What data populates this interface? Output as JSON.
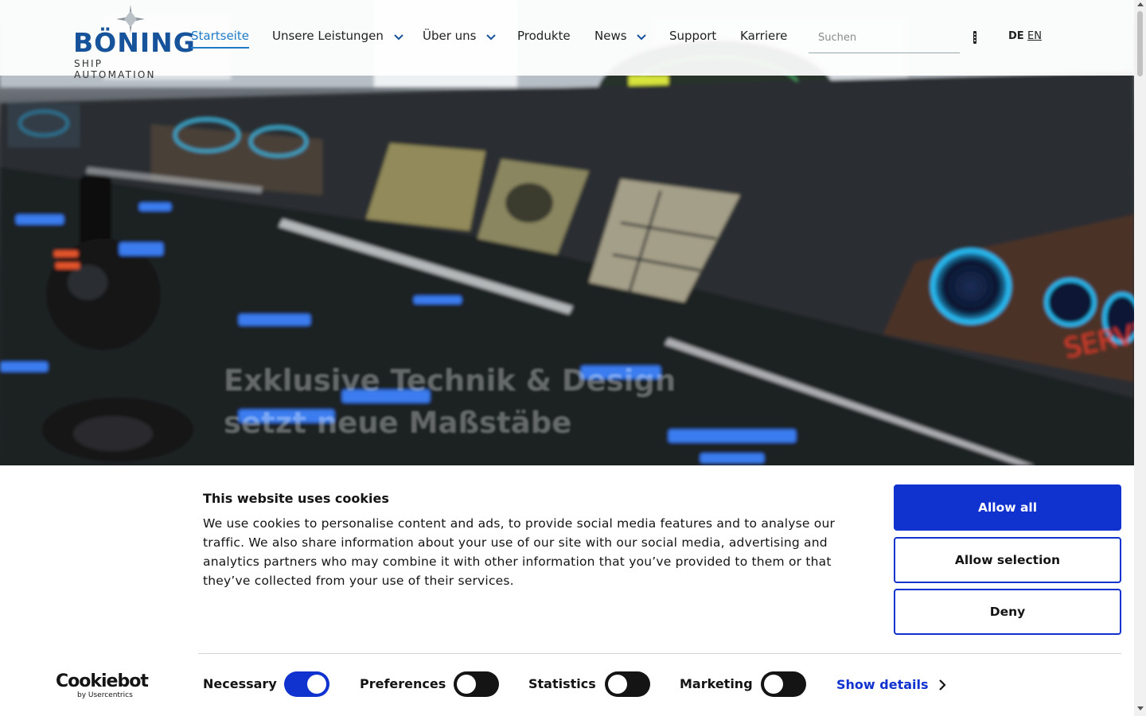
{
  "brand": {
    "name": "BÖNING",
    "tagline": "SHIP AUTOMATION",
    "primary_color": "#16539a"
  },
  "nav": {
    "items": [
      {
        "label": "Startseite",
        "active": true,
        "dropdown": false
      },
      {
        "label": "Unsere Leistungen",
        "active": false,
        "dropdown": true
      },
      {
        "label": "Über uns",
        "active": false,
        "dropdown": true
      },
      {
        "label": "Produkte",
        "active": false,
        "dropdown": false
      },
      {
        "label": "News",
        "active": false,
        "dropdown": true
      },
      {
        "label": "Support",
        "active": false,
        "dropdown": false
      },
      {
        "label": "Karriere",
        "active": false,
        "dropdown": false
      }
    ],
    "active_color": "#1f7ac6"
  },
  "search": {
    "placeholder": "Suchen",
    "value": ""
  },
  "language": {
    "current": "DE",
    "other": "EN"
  },
  "hero": {
    "title_line1": "Exklusive Technik & Design",
    "title_line2": "setzt neue Maßstäbe"
  },
  "cookie_banner": {
    "title": "This website uses cookies",
    "body": "We use cookies to personalise content and ads, to provide social media features and to analyse our traffic. We also share information about your use of our site with our social media, advertising and analytics partners who may combine it with other information that you’ve provided to them or that they’ve collected from your use of their services.",
    "buttons": {
      "allow_all": "Allow all",
      "allow_selection": "Allow selection",
      "deny": "Deny"
    },
    "provider": {
      "name": "Cookiebot",
      "sub": "by Usercentrics"
    },
    "toggles": [
      {
        "label": "Necessary",
        "on": true
      },
      {
        "label": "Preferences",
        "on": false
      },
      {
        "label": "Statistics",
        "on": false
      },
      {
        "label": "Marketing",
        "on": false
      }
    ],
    "show_details": "Show details",
    "accent_color": "#1032cf"
  }
}
